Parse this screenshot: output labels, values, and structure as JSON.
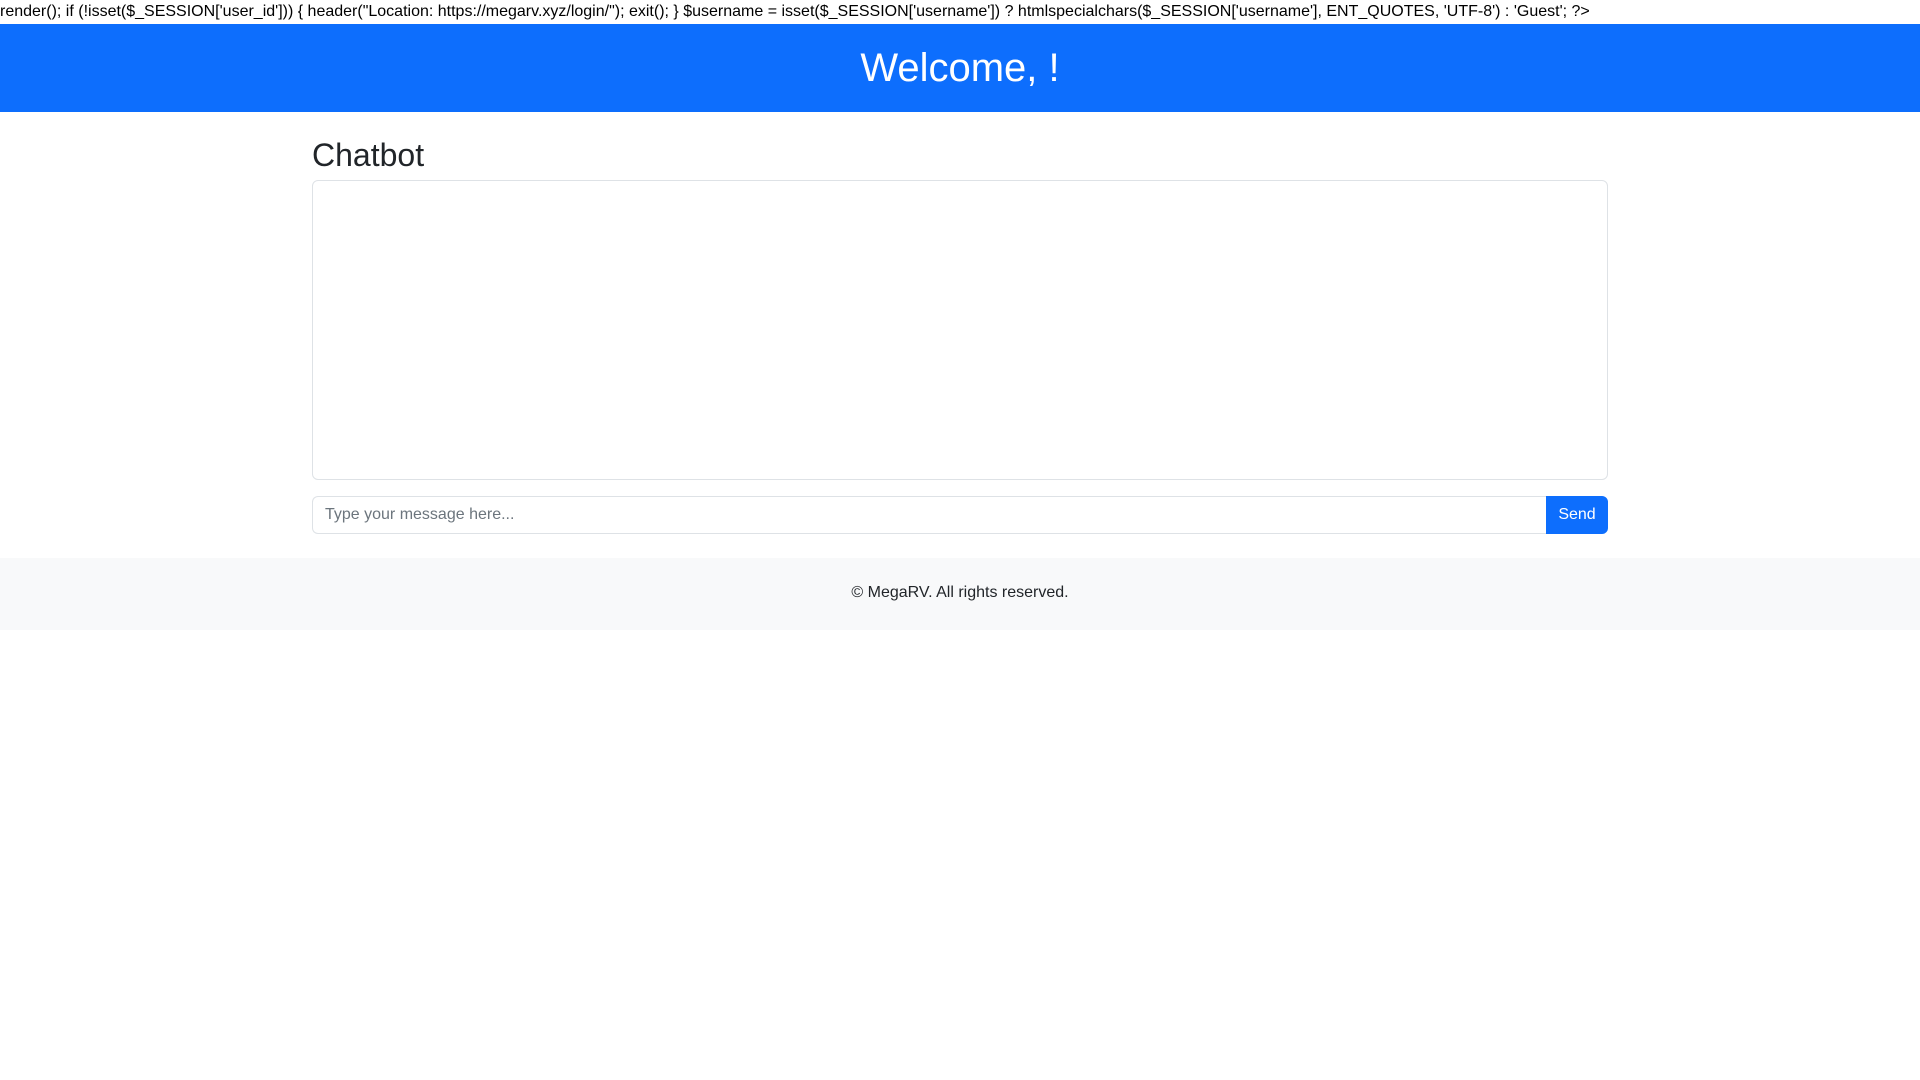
{
  "raw_code_text": "render(); if (!isset($_SESSION['user_id'])) { header(\"Location: https://megarv.xyz/login/\"); exit(); } $username = isset($_SESSION['username']) ? htmlspecialchars($_SESSION['username'], ENT_QUOTES, 'UTF-8') : 'Guest'; ?>",
  "header": {
    "title": "Welcome, !"
  },
  "main": {
    "section_title": "Chatbot",
    "chat": {
      "messages": []
    },
    "input": {
      "placeholder": "Type your message here...",
      "value": ""
    },
    "send_label": "Send"
  },
  "footer": {
    "text": "© MegaRV. All rights reserved."
  },
  "colors": {
    "primary": "#0d6efd",
    "footer_bg": "#f8f9fa",
    "border": "#dee2e6"
  }
}
